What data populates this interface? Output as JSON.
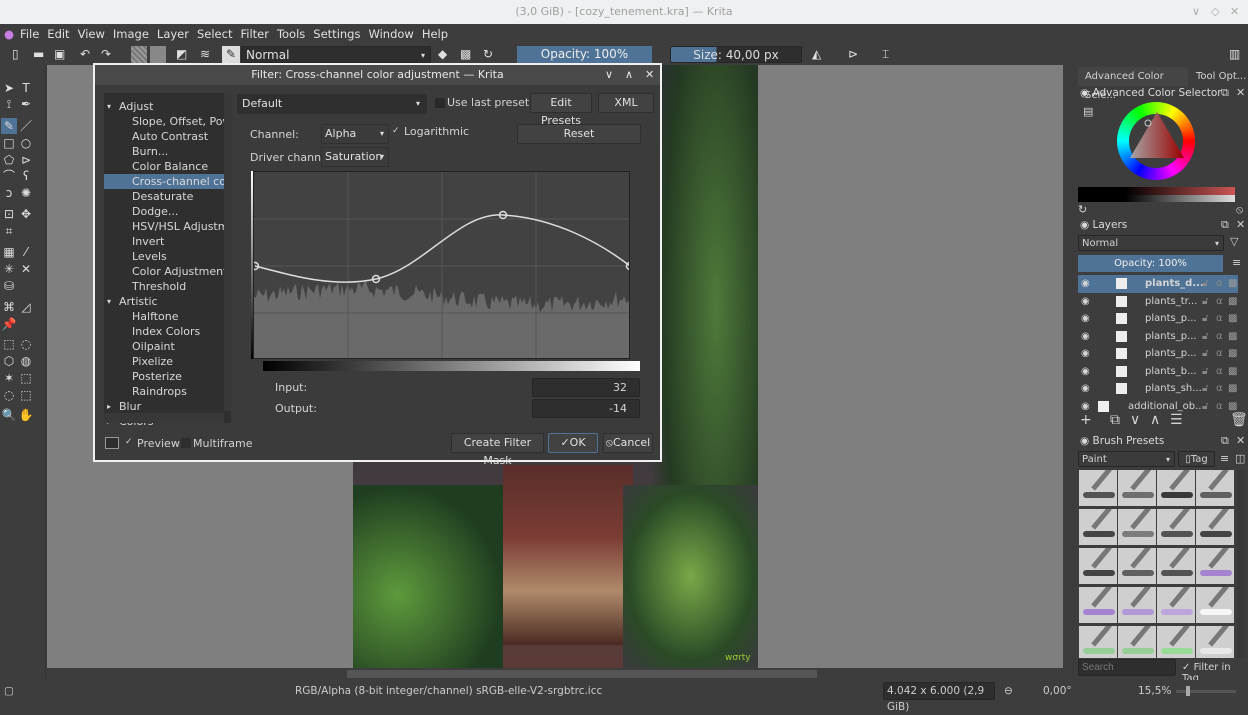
{
  "window": {
    "title": "(3,0 GiB) - [cozy_tenement.kra] — Krita"
  },
  "menu": [
    "File",
    "Edit",
    "View",
    "Image",
    "Layer",
    "Select",
    "Filter",
    "Tools",
    "Settings",
    "Window",
    "Help"
  ],
  "toolbar": {
    "blend_mode": "Normal",
    "opacity": "Opacity: 100%",
    "size": "Size: 40,00 px"
  },
  "dialog": {
    "title": "Filter: Cross-channel color adjustment — Krita",
    "preset": "Default",
    "use_last_preset": "Use last preset",
    "edit_presets": "Edit Presets",
    "xml": "XML",
    "channel_label": "Channel:",
    "channel": "Alpha",
    "logarithmic": "Logarithmic",
    "reset": "Reset",
    "driver_label": "Driver channel",
    "driver": "Saturation",
    "input_label": "Input:",
    "input": "32",
    "output_label": "Output:",
    "output": "-14",
    "preview": "Preview",
    "multiframe": "Multiframe",
    "create_mask": "Create Filter Mask",
    "ok": "OK",
    "cancel": "Cancel",
    "tree": [
      {
        "label": "Adjust",
        "level": 0
      },
      {
        "label": "Slope, Offset, Power",
        "level": 1
      },
      {
        "label": "Auto Contrast",
        "level": 1
      },
      {
        "label": "Burn...",
        "level": 1
      },
      {
        "label": "Color Balance",
        "level": 1
      },
      {
        "label": "Cross-channel color adjustment",
        "level": 1,
        "selected": true
      },
      {
        "label": "Desaturate",
        "level": 1
      },
      {
        "label": "Dodge...",
        "level": 1
      },
      {
        "label": "HSV/HSL Adjustment",
        "level": 1
      },
      {
        "label": "Invert",
        "level": 1
      },
      {
        "label": "Levels",
        "level": 1
      },
      {
        "label": "Color Adjustment",
        "level": 1
      },
      {
        "label": "Threshold",
        "level": 1
      },
      {
        "label": "Artistic",
        "level": 0
      },
      {
        "label": "Halftone",
        "level": 1
      },
      {
        "label": "Index Colors",
        "level": 1
      },
      {
        "label": "Oilpaint",
        "level": 1
      },
      {
        "label": "Pixelize",
        "level": 1
      },
      {
        "label": "Posterize",
        "level": 1
      },
      {
        "label": "Raindrops",
        "level": 1
      },
      {
        "label": "Blur",
        "level": 0
      },
      {
        "label": "Colors",
        "level": 0
      }
    ]
  },
  "dock": {
    "tabs": [
      "Advanced Color Sele...",
      "Tool Opt..."
    ],
    "color_selector_title": "Advanced Color Selector",
    "layers_title": "Layers",
    "layers_blend": "Normal",
    "layers_opacity": "Opacity:  100%",
    "layers": [
      {
        "name": "plants_d...",
        "selected": true
      },
      {
        "name": "plants_tr..."
      },
      {
        "name": "plants_p..."
      },
      {
        "name": "plants_p..."
      },
      {
        "name": "plants_p..."
      },
      {
        "name": "plants_b..."
      },
      {
        "name": "plants_sh..."
      },
      {
        "name": "additional_ob..."
      }
    ],
    "brush_title": "Brush Presets",
    "brush_tag": "Paint",
    "tag_label": "Tag",
    "search_placeholder": "Search",
    "filter_in_tag": "Filter in Tag"
  },
  "status": {
    "color_info": "RGB/Alpha (8-bit integer/channel)  sRGB-elle-V2-srgbtrc.icc",
    "dimensions": "4.042 x 6.000 (2,9 GiB)",
    "rotation": "0,00°",
    "zoom": "15,5%"
  },
  "colors": {
    "accent": "#4f7396",
    "panel": "#3d3d3d",
    "canvas": "#7f7f7f"
  }
}
